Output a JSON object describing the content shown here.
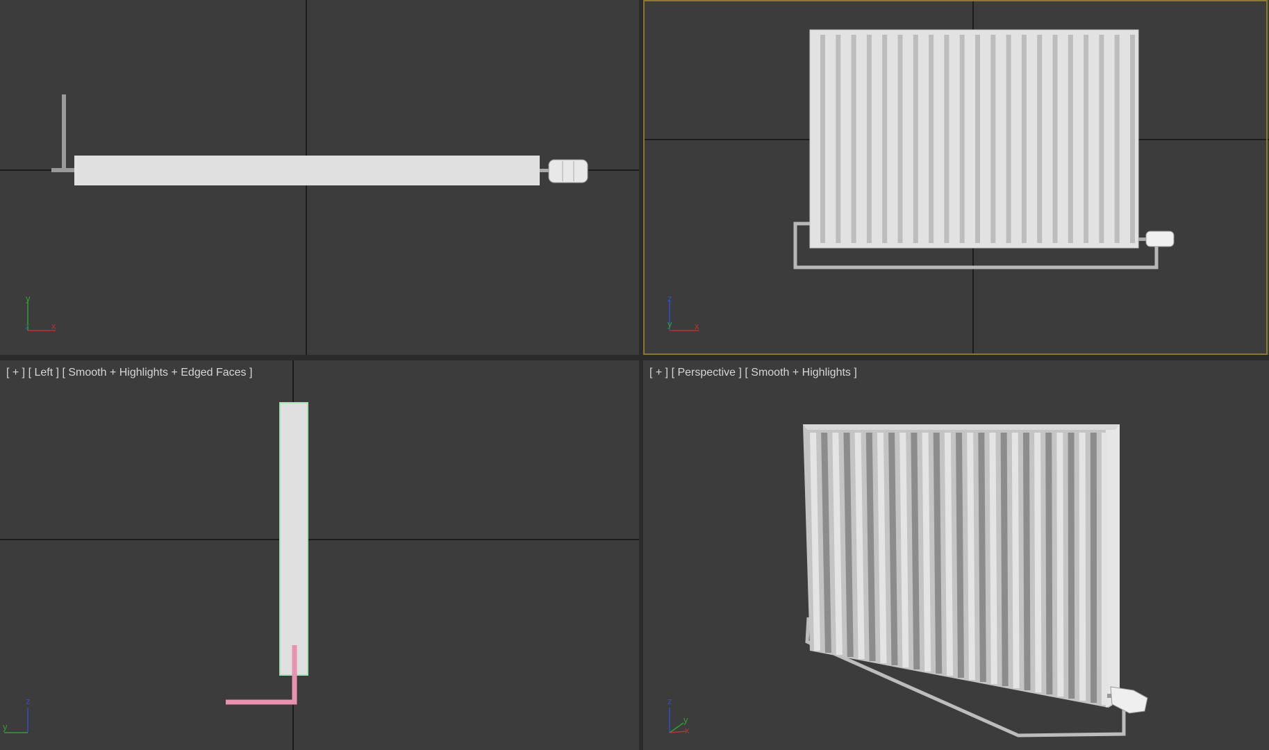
{
  "viewports": {
    "top": {
      "gizmo": {
        "up": "y",
        "center": "z",
        "right": "x"
      }
    },
    "front": {
      "gizmo": {
        "up": "z",
        "center": "y",
        "right": "x"
      }
    },
    "left": {
      "label": "[ + ] [ Left ] [ Smooth + Highlights + Edged Faces ]",
      "gizmo": {
        "up": "z",
        "left": "y"
      }
    },
    "perspective": {
      "label": "[ + ] [ Perspective ] [ Smooth + Highlights ]",
      "gizmo": {
        "up": "z",
        "center": "y",
        "right": "x"
      }
    }
  },
  "colors": {
    "viewport_bg": "#3c3c3c",
    "grid_line": "#111111",
    "active_border": "#8a7a2a",
    "model": "#e0e0e0",
    "selected_pipe": "#e892b0",
    "axis_x": "#c03030",
    "axis_y": "#30a030",
    "axis_z": "#3050c0"
  }
}
